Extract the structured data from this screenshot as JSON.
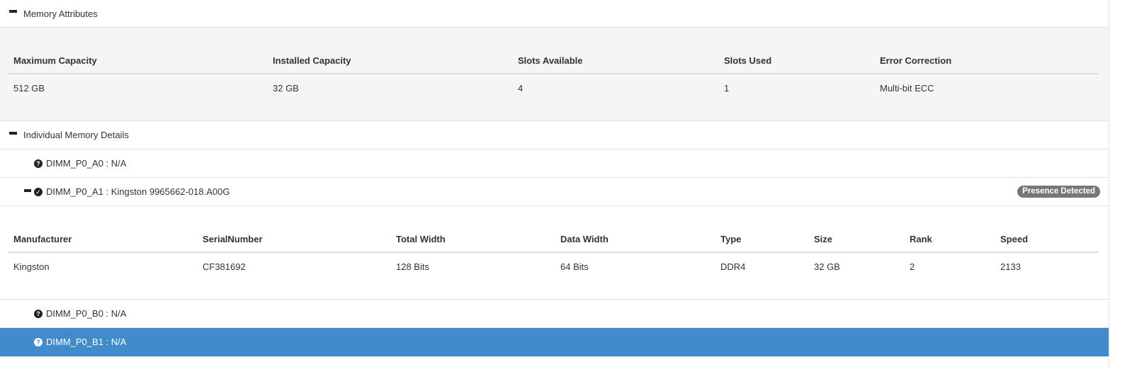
{
  "memory_attributes": {
    "title": "Memory Attributes",
    "columns": [
      "Maximum Capacity",
      "Installed Capacity",
      "Slots Available",
      "Slots Used",
      "Error Correction"
    ],
    "values": [
      "512 GB",
      "32 GB",
      "4",
      "1",
      "Multi-bit ECC"
    ]
  },
  "individual_details": {
    "title": "Individual Memory Details",
    "dimms": [
      {
        "label": "DIMM_P0_A0 : N/A",
        "status": "unknown"
      },
      {
        "label": "DIMM_P0_A1 : Kingston 9965662-018.A00G",
        "status": "ok",
        "badge": "Presence Detected"
      },
      {
        "label": "DIMM_P0_B0 : N/A",
        "status": "unknown"
      },
      {
        "label": "DIMM_P0_B1 : N/A",
        "status": "unknown",
        "selected": true
      }
    ],
    "detail_columns": [
      "Manufacturer",
      "SerialNumber",
      "Total Width",
      "Data Width",
      "Type",
      "Size",
      "Rank",
      "Speed"
    ],
    "detail_values": [
      "Kingston",
      "CF381692",
      "128 Bits",
      "64 Bits",
      "DDR4",
      "32 GB",
      "2",
      "2133"
    ]
  },
  "icons": {
    "collapse": "minus-icon",
    "unknown": "question-circle-icon",
    "ok": "check-circle-icon"
  },
  "colors": {
    "selected_row": "#428bca",
    "badge": "#777777",
    "panel_grey": "#f5f5f5"
  }
}
